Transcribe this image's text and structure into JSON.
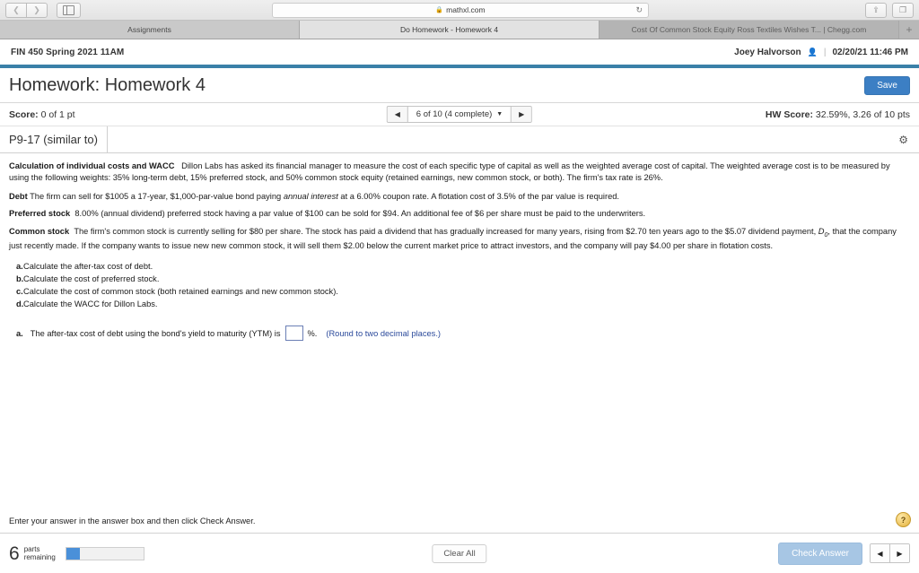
{
  "browser": {
    "back_icon": "chevron-left-icon",
    "forward_icon": "chevron-right-icon",
    "sidebar_icon": "sidebar-toggle-icon",
    "url": "mathxl.com",
    "lock_icon": "lock-icon",
    "reload_icon": "reload-icon",
    "share_icon": "share-icon",
    "tabs_overview_icon": "tabs-overview-icon",
    "new_tab_label": "+",
    "tabs": [
      {
        "label": "Assignments",
        "active": false
      },
      {
        "label": "Do Homework - Homework 4",
        "active": true
      },
      {
        "label": "Cost Of Common Stock Equity Ross Textiles Wishes T... | Chegg.com",
        "active": false
      }
    ]
  },
  "header": {
    "course": "FIN 450 Spring 2021 11AM",
    "user_name": "Joey Halvorson",
    "user_icon": "person-icon",
    "separator": "|",
    "timestamp": "02/20/21 11:46 PM",
    "title": "Homework: Homework 4",
    "save_label": "Save"
  },
  "score_bar": {
    "score_label": "Score:",
    "score_value": "0 of 1 pt",
    "nav_prev_icon": "triangle-left-icon",
    "nav_next_icon": "triangle-right-icon",
    "question_selector": "6 of 10 (4 complete)",
    "caret_icon": "caret-down-icon",
    "hw_score_label": "HW Score:",
    "hw_score_value": "32.59%, 3.26 of 10 pts"
  },
  "problem_tab": {
    "label": "P9-17 (similar to)",
    "settings_icon": "gear-icon"
  },
  "problem": {
    "intro_bold": "Calculation of individual costs and WACC",
    "intro_text": "Dillon Labs has asked its financial manager to measure the cost of each specific type of capital as well as the weighted average cost of capital.  The weighted average cost is to be measured by using the following weights: 35% long-term debt, 15% preferred stock, and 50% common stock equity (retained earnings, new common stock, or both).  The firm's tax rate is 26%.",
    "debt_bold": "Debt",
    "debt_text_1": "The firm can sell for $1005 a 17-year, $1,000-par-value bond paying",
    "debt_italic": "annual interest",
    "debt_text_2": "at a 6.00% coupon rate.  A flotation cost of 3.5% of the par value is required.",
    "preferred_bold": "Preferred stock",
    "preferred_text": "8.00% (annual dividend) preferred stock having a par value of $100 can be sold for $94.  An additional fee of $6 per share must be paid to the underwriters.",
    "common_bold": "Common stock",
    "common_text_1": "The firm's common stock is currently selling for $80 per share. The stock has paid a dividend that has  gradually increased for many years, rising from $2.70 ten years ago to the $5.07 dividend payment,",
    "common_symbol": "D",
    "common_symbol_sub": "0",
    "common_text_2": ", that the company just recently made.  If the company wants to issue new new common stock, it will sell them $2.00 below the current market price to attract investors, and the company will  pay $4.00 per share in flotation costs.",
    "tasks": [
      {
        "letter": "a.",
        "text": "Calculate the after-tax cost of debt."
      },
      {
        "letter": "b.",
        "text": "Calculate the cost of preferred stock."
      },
      {
        "letter": "c.",
        "text": "Calculate the cost of common stock (both retained earnings and new common stock)."
      },
      {
        "letter": "d.",
        "text": "Calculate the WACC for Dillon Labs."
      }
    ],
    "question": {
      "letter": "a.",
      "text": "The after-tax cost of debt using the bond's yield to maturity (YTM) is",
      "answer_value": "",
      "unit": "%.",
      "hint": "(Round to two decimal places.)"
    }
  },
  "footer": {
    "message": "Enter your answer in the answer box and then click Check Answer.",
    "help_icon": "question-mark-icon",
    "parts_count": "6",
    "parts_label_line1": "parts",
    "parts_label_line2": "remaining",
    "progress_percent": 18,
    "clear_all_label": "Clear All",
    "check_answer_label": "Check Answer",
    "prev_icon": "triangle-left-icon",
    "next_icon": "triangle-right-icon"
  },
  "colors": {
    "accent_blue": "#3c7fc4",
    "teal_rule": "#3a80a8",
    "hint_blue": "#2b4a9b",
    "progress_fill": "#4a90d9",
    "check_disabled": "#a7c6e4"
  }
}
